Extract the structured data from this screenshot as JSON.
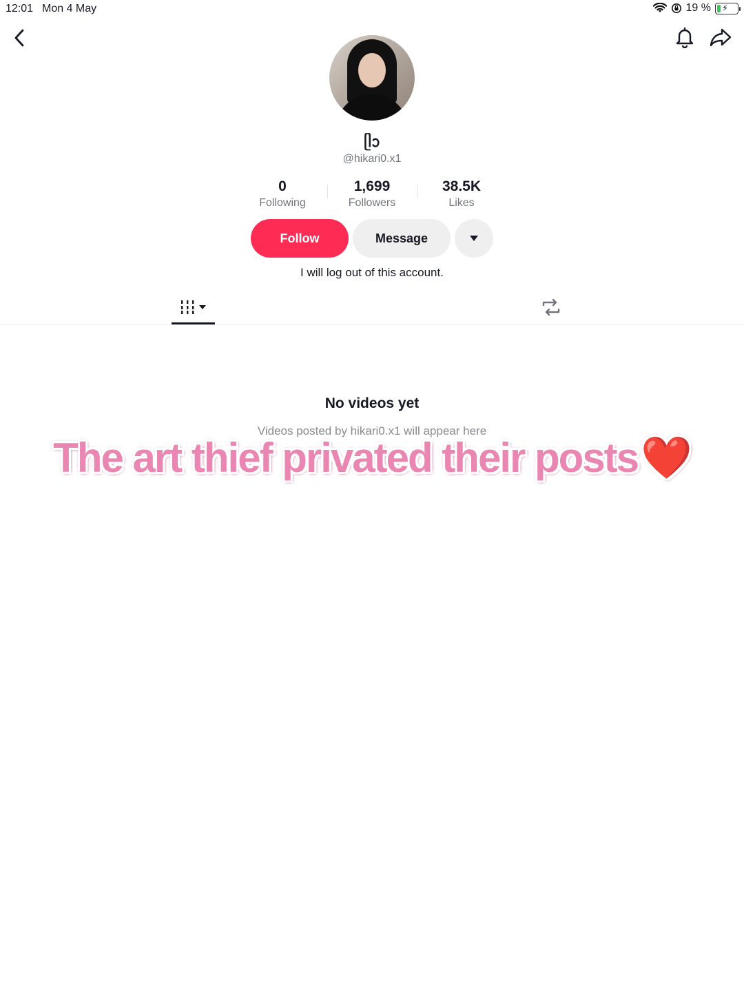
{
  "status_bar": {
    "time": "12:01",
    "date": "Mon 4 May",
    "battery_percent": "19 %",
    "battery_level": 0.19
  },
  "profile": {
    "display_name": "ᥫᩣ",
    "username": "@hikari0.x1",
    "bio": "I will log out of this account.",
    "stats": [
      {
        "value": "0",
        "label": "Following"
      },
      {
        "value": "1,699",
        "label": "Followers"
      },
      {
        "value": "38.5K",
        "label": "Likes"
      }
    ]
  },
  "actions": {
    "follow_label": "Follow",
    "message_label": "Message"
  },
  "empty_state": {
    "title": "No videos yet",
    "subtitle": "Videos posted by hikari0.x1 will appear here"
  },
  "overlay": {
    "caption": "The art thief privated their posts",
    "emoji": "❤️"
  },
  "colors": {
    "follow_button": "#fe2c55",
    "secondary_button": "#efeff0",
    "overlay_text": "#e987b2"
  },
  "icons": {
    "back": "chevron-left-icon",
    "notifications": "bell-icon",
    "share": "share-arrow-icon",
    "videos_tab": "grid-bars-icon",
    "reposts_tab": "repost-icon",
    "more": "caret-down-icon"
  }
}
